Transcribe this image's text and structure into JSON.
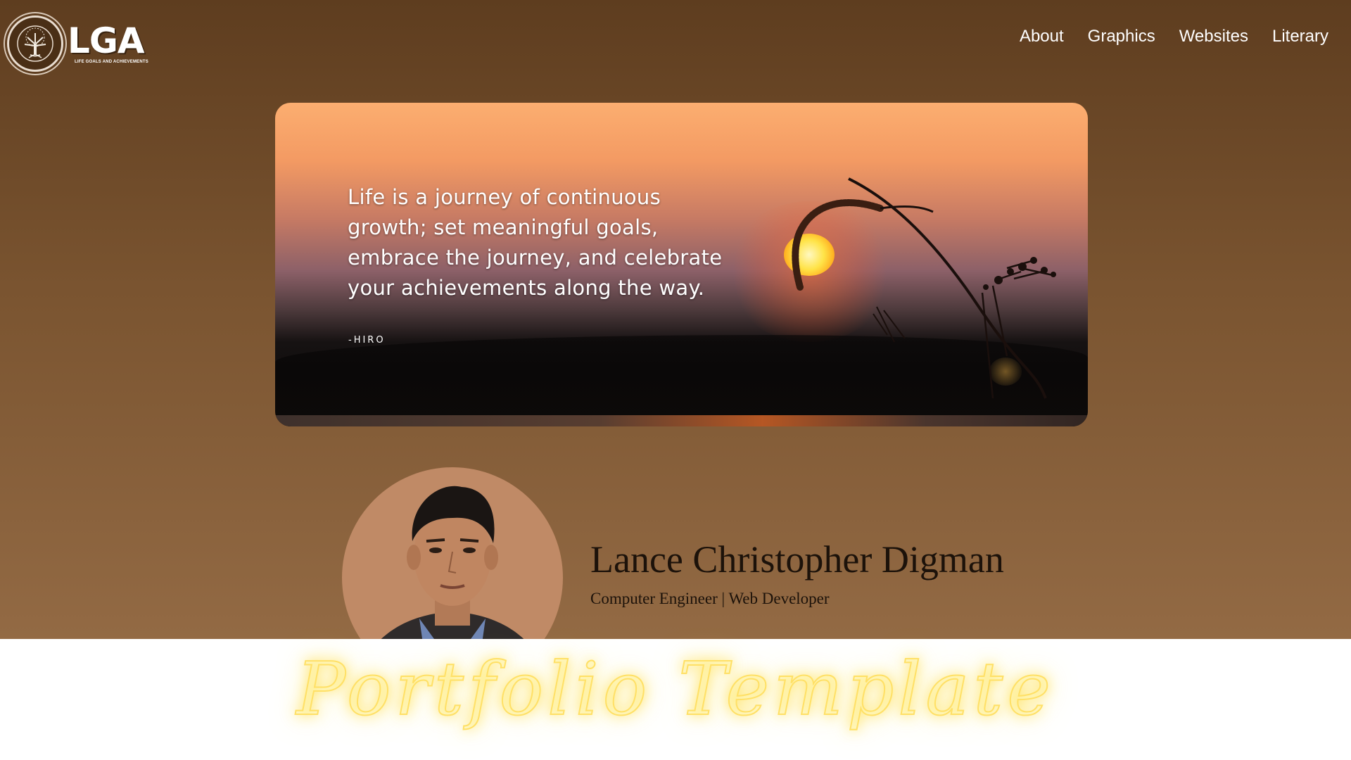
{
  "brand": {
    "logo_text": "LGA",
    "logo_subtitle": "LIFE GOALS AND ACHIEVEMENTS"
  },
  "nav": {
    "items": [
      "About",
      "Graphics",
      "Websites",
      "Literary"
    ]
  },
  "hero": {
    "quote": "Life is a journey of continuous growth; set meaningful goals, embrace the journey, and celebrate your achievements along the way.",
    "author": "-HIRO"
  },
  "profile": {
    "name": "Lance Christopher Digman",
    "role": "Computer Engineer | Web Developer"
  },
  "watermark": {
    "text": "Portfolio Template"
  },
  "colors": {
    "header_bg": "#5e3d1f",
    "accent_glow": "#ffe066"
  }
}
